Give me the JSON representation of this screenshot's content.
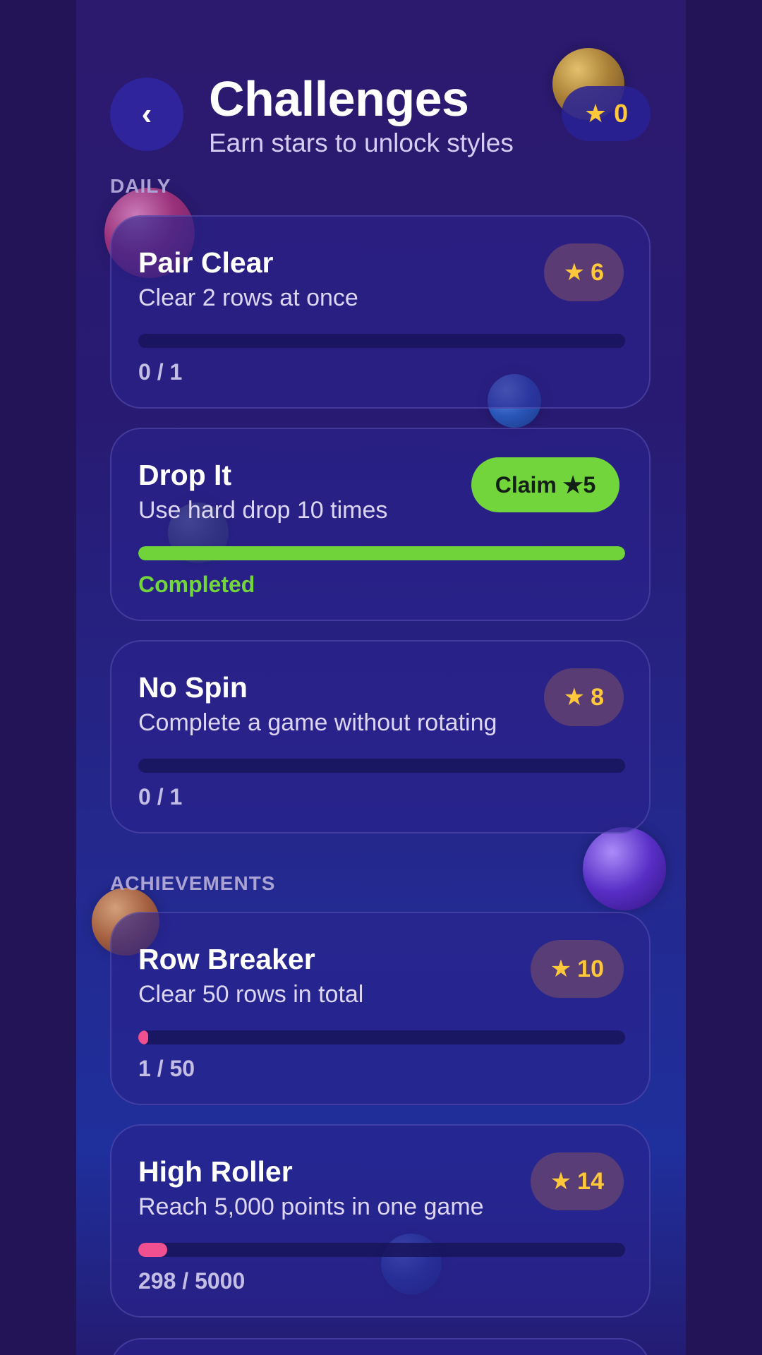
{
  "header": {
    "back_label": "‹",
    "title": "Challenges",
    "subtitle": "Earn stars to unlock styles",
    "star_icon": "★",
    "star_count": "0"
  },
  "sections": {
    "daily_label": "DAILY",
    "achievements_label": "ACHIEVEMENTS"
  },
  "daily": [
    {
      "title": "Pair Clear",
      "description": "Clear 2 rows at once",
      "reward_icon": "★",
      "reward": "6",
      "progress_text": "0 / 1",
      "progress": 0
    },
    {
      "title": "Drop It",
      "description": "Use hard drop 10 times",
      "claim_label": "Claim ★5",
      "progress_text": "Completed",
      "progress": 1
    },
    {
      "title": "No Spin",
      "description": "Complete a game without rotating",
      "reward_icon": "★",
      "reward": "8",
      "progress_text": "0 / 1",
      "progress": 0
    }
  ],
  "achievements": [
    {
      "title": "Row Breaker",
      "description": "Clear 50 rows in total",
      "reward_icon": "★",
      "reward": "10",
      "progress_text": "1 / 50",
      "progress": 0.02
    },
    {
      "title": "High Roller",
      "description": "Reach 5,000 points in one game",
      "reward_icon": "★",
      "reward": "14",
      "progress_text": "298 / 5000",
      "progress": 0.0596
    }
  ],
  "colors": {
    "accent_green": "#72d53b",
    "star_gold": "#ffc83a",
    "progress_pink": "#f0508f"
  }
}
